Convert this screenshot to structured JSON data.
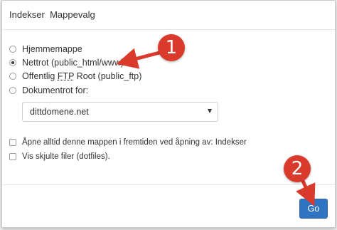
{
  "dialog": {
    "title": "Indekser  Mappevalg"
  },
  "options": [
    {
      "label": "Hjemmemappe",
      "checked": false
    },
    {
      "label": "Nettrot (public_html/www)",
      "checked": true
    },
    {
      "label_prefix": "Offentlig ",
      "label_abbr": "FTP",
      "label_suffix": " Root (public_ftp)",
      "checked": false
    },
    {
      "label": "Dokumentrot for:",
      "checked": false
    }
  ],
  "domain_select": {
    "value": "dittdomene.net"
  },
  "checkboxes": [
    {
      "label": "Åpne alltid denne mappen i fremtiden ved åpning av: Indekser",
      "checked": false
    },
    {
      "label": "Vis skjulte filer (dotfiles).",
      "checked": false
    }
  ],
  "footer": {
    "go_label": "Go"
  },
  "annotations": {
    "step1": "1",
    "step2": "2",
    "color": "#d93a2b"
  },
  "colors": {
    "primary_button": "#2f74c0",
    "annotation_red": "#d93a2b"
  }
}
